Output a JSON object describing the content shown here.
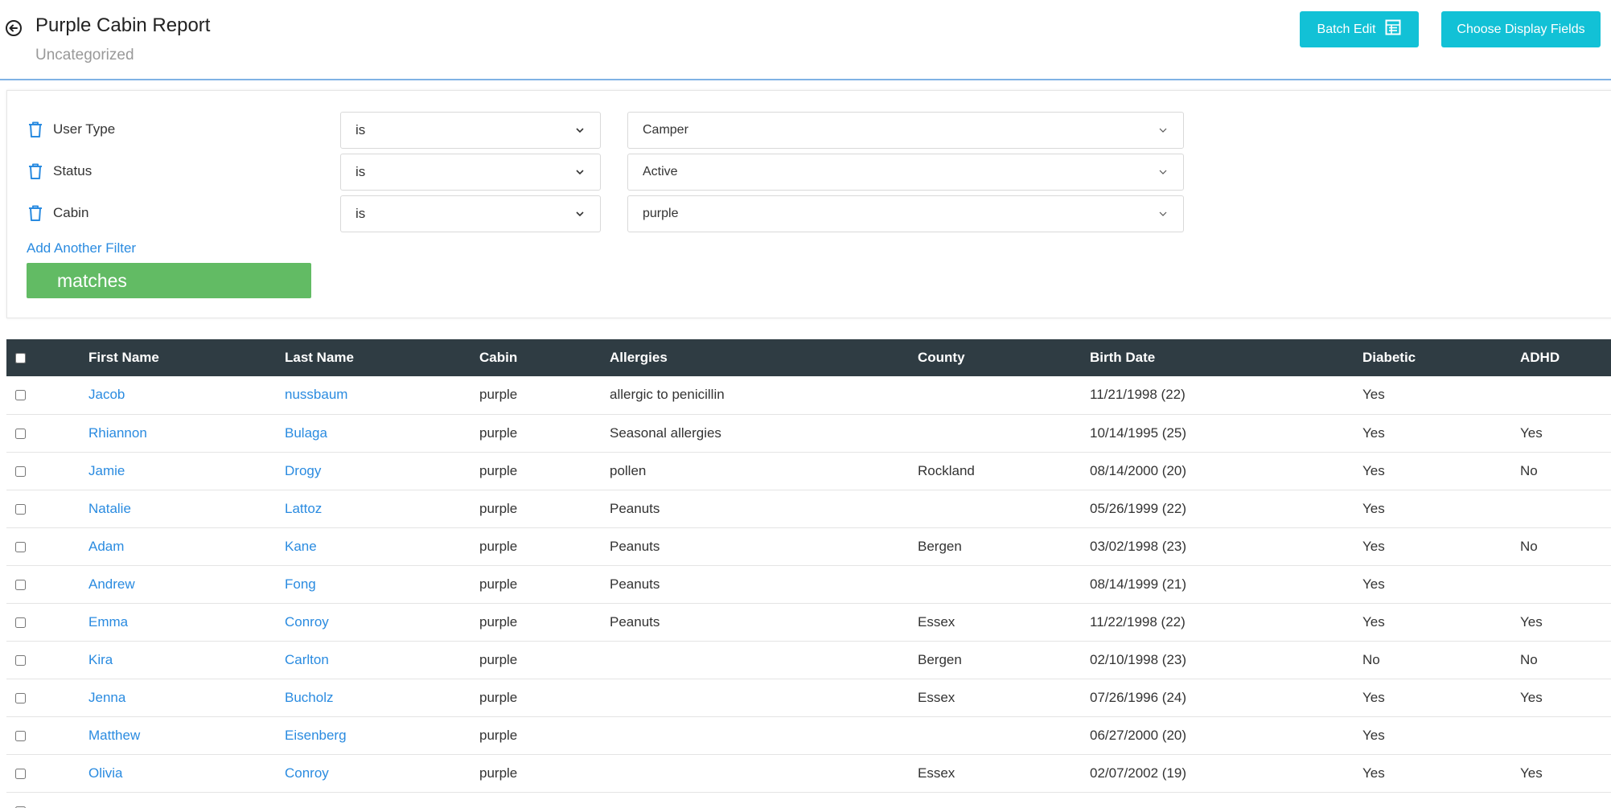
{
  "header": {
    "title": "Purple Cabin Report",
    "subtitle": "Uncategorized",
    "batch_edit_label": "Batch Edit",
    "choose_fields_label": "Choose Display Fields"
  },
  "filters": [
    {
      "field": "User Type",
      "operator": "is",
      "value": "Camper"
    },
    {
      "field": "Status",
      "operator": "is",
      "value": "Active"
    },
    {
      "field": "Cabin",
      "operator": "is",
      "value": "purple"
    }
  ],
  "add_filter_label": "Add Another Filter",
  "match_label": "matches",
  "table": {
    "columns": [
      "First Name",
      "Last Name",
      "Cabin",
      "Allergies",
      "County",
      "Birth Date",
      "Diabetic",
      "ADHD"
    ],
    "rows": [
      {
        "first": "Jacob",
        "last": "nussbaum",
        "cabin": "purple",
        "allergies": "allergic to penicillin",
        "county": "",
        "birth": "11/21/1998 (22)",
        "diabetic": "Yes",
        "adhd": ""
      },
      {
        "first": "Rhiannon",
        "last": "Bulaga",
        "cabin": "purple",
        "allergies": "Seasonal allergies",
        "county": "",
        "birth": "10/14/1995 (25)",
        "diabetic": "Yes",
        "adhd": "Yes"
      },
      {
        "first": "Jamie",
        "last": "Drogy",
        "cabin": "purple",
        "allergies": "pollen",
        "county": "Rockland",
        "birth": "08/14/2000 (20)",
        "diabetic": "Yes",
        "adhd": "No"
      },
      {
        "first": "Natalie",
        "last": "Lattoz",
        "cabin": "purple",
        "allergies": "Peanuts",
        "county": "",
        "birth": "05/26/1999 (22)",
        "diabetic": "Yes",
        "adhd": ""
      },
      {
        "first": "Adam",
        "last": "Kane",
        "cabin": "purple",
        "allergies": "Peanuts",
        "county": "Bergen",
        "birth": "03/02/1998 (23)",
        "diabetic": "Yes",
        "adhd": "No"
      },
      {
        "first": "Andrew",
        "last": "Fong",
        "cabin": "purple",
        "allergies": "Peanuts",
        "county": "",
        "birth": "08/14/1999 (21)",
        "diabetic": "Yes",
        "adhd": ""
      },
      {
        "first": "Emma",
        "last": "Conroy",
        "cabin": "purple",
        "allergies": "Peanuts",
        "county": "Essex",
        "birth": "11/22/1998 (22)",
        "diabetic": "Yes",
        "adhd": "Yes"
      },
      {
        "first": "Kira",
        "last": "Carlton",
        "cabin": "purple",
        "allergies": "",
        "county": "Bergen",
        "birth": "02/10/1998 (23)",
        "diabetic": "No",
        "adhd": "No"
      },
      {
        "first": "Jenna",
        "last": "Bucholz",
        "cabin": "purple",
        "allergies": "",
        "county": "Essex",
        "birth": "07/26/1996 (24)",
        "diabetic": "Yes",
        "adhd": "Yes"
      },
      {
        "first": "Matthew",
        "last": "Eisenberg",
        "cabin": "purple",
        "allergies": "",
        "county": "",
        "birth": "06/27/2000 (20)",
        "diabetic": "Yes",
        "adhd": ""
      },
      {
        "first": "Olivia",
        "last": "Conroy",
        "cabin": "purple",
        "allergies": "",
        "county": "Essex",
        "birth": "02/07/2002 (19)",
        "diabetic": "Yes",
        "adhd": "Yes"
      },
      {
        "first": "",
        "last": "",
        "cabin": "",
        "allergies": "",
        "county": "",
        "birth": "",
        "diabetic": "",
        "adhd": ""
      }
    ]
  },
  "colors": {
    "accent_teal": "#12c1d6",
    "link_blue": "#2a8be0",
    "match_green": "#62bb64",
    "table_header": "#2f3c43",
    "header_border": "#7fb2e5"
  },
  "icons": {
    "back": "arrow-left-circle-icon",
    "batch_edit": "table-grid-icon",
    "remove_filter": "trash-icon",
    "dropdown": "chevron-down-icon"
  }
}
